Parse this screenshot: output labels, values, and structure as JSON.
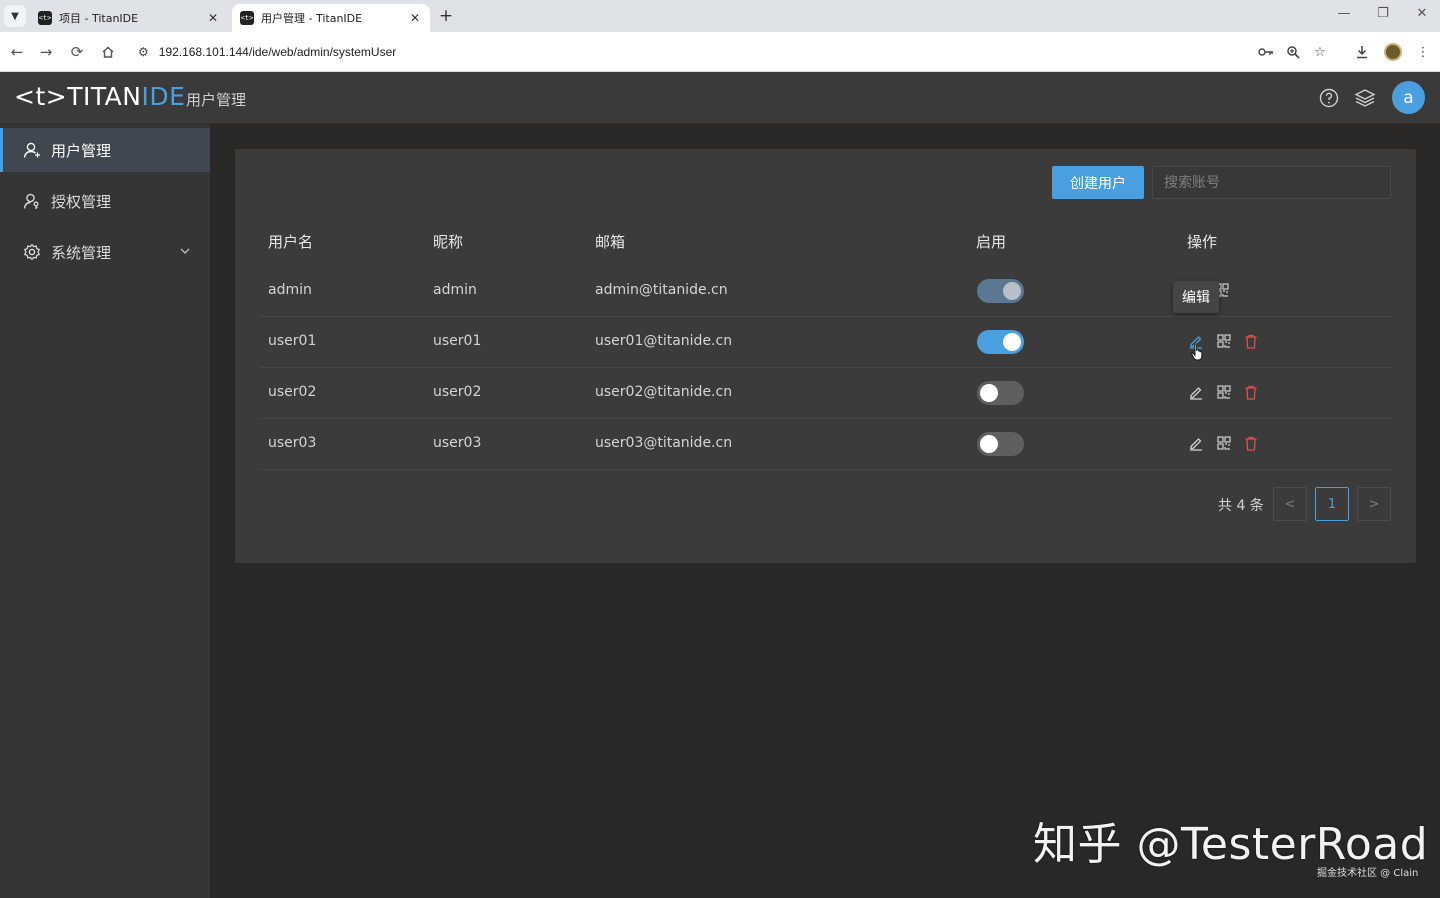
{
  "browser": {
    "tabs": [
      {
        "label": "项目 - TitanIDE",
        "favicon": "<t>",
        "active": false
      },
      {
        "label": "用户管理 - TitanIDE",
        "favicon": "<t>",
        "active": true
      }
    ],
    "url": "192.168.101.144/ide/web/admin/systemUser"
  },
  "app": {
    "logo": {
      "prefix": "<t>TITAN",
      "accent": "IDE"
    },
    "header_title": "用户管理",
    "avatar_letter": "a",
    "accent_color": "#4a9fe0"
  },
  "sidebar": {
    "items": [
      {
        "label": "用户管理",
        "icon": "user-icon",
        "active": true
      },
      {
        "label": "授权管理",
        "icon": "user-key-icon",
        "active": false
      },
      {
        "label": "系统管理",
        "icon": "gear-icon",
        "active": false,
        "expandable": true
      }
    ]
  },
  "toolbar": {
    "create_label": "创建用户",
    "search_placeholder": "搜索账号",
    "search_value": ""
  },
  "table": {
    "columns": [
      "用户名",
      "昵称",
      "邮箱",
      "启用",
      "操作"
    ],
    "rows": [
      {
        "username": "admin",
        "nickname": "admin",
        "email": "admin@titanide.cn",
        "enabled": true
      },
      {
        "username": "user01",
        "nickname": "user01",
        "email": "user01@titanide.cn",
        "enabled": true
      },
      {
        "username": "user02",
        "nickname": "user02",
        "email": "user02@titanide.cn",
        "enabled": false
      },
      {
        "username": "user03",
        "nickname": "user03",
        "email": "user03@titanide.cn",
        "enabled": false
      }
    ]
  },
  "tooltip": {
    "text": "编辑"
  },
  "pagination": {
    "total_text": "共 4 条",
    "current_page": "1",
    "prev": "<",
    "next": ">"
  },
  "watermark": {
    "main": "知乎 @TesterRoad",
    "sub": "掘金技术社区 @ Clain"
  }
}
